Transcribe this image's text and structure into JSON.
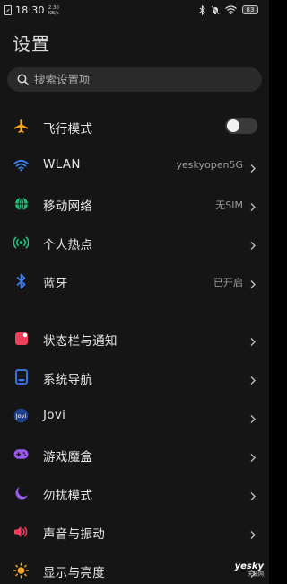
{
  "status_bar": {
    "time": "18:30",
    "speed_value": "2.30",
    "speed_unit": "KB/s",
    "battery": "83"
  },
  "page_title": "设置",
  "search": {
    "placeholder": "搜索设置项"
  },
  "items": [
    {
      "label": "飞行模式",
      "value": "",
      "icon": "airplane-icon",
      "color": "#f5a623"
    },
    {
      "label": "WLAN",
      "value": "yeskyopen5G",
      "icon": "wifi-icon",
      "color": "#3b7bf6"
    },
    {
      "label": "移动网络",
      "value": "无SIM",
      "icon": "globe-icon",
      "color": "#1ec47b"
    },
    {
      "label": "个人热点",
      "value": "",
      "icon": "hotspot-icon",
      "color": "#1ec47b"
    },
    {
      "label": "蓝牙",
      "value": "已开启",
      "icon": "bluetooth-icon",
      "color": "#3b7bf6"
    },
    {
      "label": "状态栏与通知",
      "value": "",
      "icon": "notification-icon",
      "color": "#f0405a"
    },
    {
      "label": "系统导航",
      "value": "",
      "icon": "navigation-icon",
      "color": "#3b7bf6"
    },
    {
      "label": "Jovi",
      "value": "",
      "icon": "jovi-icon",
      "color": "#3b7bf6"
    },
    {
      "label": "游戏魔盒",
      "value": "",
      "icon": "gamepad-icon",
      "color": "#9b59f0"
    },
    {
      "label": "勿扰模式",
      "value": "",
      "icon": "moon-icon",
      "color": "#9b59f0"
    },
    {
      "label": "声音与振动",
      "value": "",
      "icon": "speaker-icon",
      "color": "#f0405a"
    },
    {
      "label": "显示与亮度",
      "value": "",
      "icon": "sun-icon",
      "color": "#f5a623"
    }
  ],
  "airplane_mode_on": false,
  "watermark": {
    "main": "yesky",
    "sub": "天极网"
  }
}
